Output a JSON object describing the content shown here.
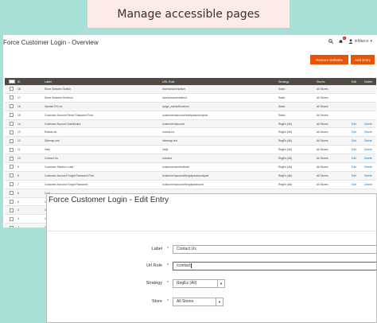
{
  "banner": {
    "text": "Manage accessible pages"
  },
  "overview": {
    "title": "Force Customer Login - Overview",
    "user": "leMarco",
    "notifications": "1",
    "buttons": {
      "restore": "Restore Defaults",
      "add": "Add Entry"
    },
    "columns": [
      "ID",
      "Label",
      "URL Rule",
      "Strategy",
      "Stores",
      "Edit",
      "Delete"
    ],
    "rows": [
      {
        "id": "18",
        "label": "Store Switcher Switch",
        "url": "/stores/store/switch",
        "strategy": "Static",
        "stores": "All Stores",
        "edit": "",
        "delete": ""
      },
      {
        "id": "17",
        "label": "Store Switcher Redirect",
        "url": "/stores/store/redirect",
        "strategy": "Static",
        "stores": "All Stores",
        "edit": "",
        "delete": ""
      },
      {
        "id": "16",
        "label": "Varnish ESI url",
        "url": "/page_cache/block/esi",
        "strategy": "Static",
        "stores": "All Stores",
        "edit": "",
        "delete": ""
      },
      {
        "id": "15",
        "label": "Customer Account Reset Password Post",
        "url": "/customer/account/resetpasswordpost",
        "strategy": "Static",
        "stores": "All Stores",
        "edit": "",
        "delete": ""
      },
      {
        "id": "14",
        "label": "Customer Account Dashboard",
        "url": "/customer/account",
        "strategy": "RegEx (All)",
        "stores": "All Stores",
        "edit": "Edit",
        "delete": "Delete"
      },
      {
        "id": "13",
        "label": "Robots.txt",
        "url": "/robots.txt",
        "strategy": "RegEx (All)",
        "stores": "All Stores",
        "edit": "Edit",
        "delete": "Delete"
      },
      {
        "id": "12",
        "label": "Sitemap.xml",
        "url": "/sitemap.xml",
        "strategy": "RegEx (All)",
        "stores": "All Stores",
        "edit": "Edit",
        "delete": "Delete"
      },
      {
        "id": "11",
        "label": "Help",
        "url": "/help",
        "strategy": "RegEx (All)",
        "stores": "All Stores",
        "edit": "Edit",
        "delete": "Delete"
      },
      {
        "id": "10",
        "label": "Contact Us",
        "url": "/contact",
        "strategy": "RegEx (All)",
        "stores": "All Stores",
        "edit": "Edit",
        "delete": "Delete"
      },
      {
        "id": "9",
        "label": "Customer Session Load",
        "url": "/customer/section/load",
        "strategy": "RegEx (All)",
        "stores": "All Stores",
        "edit": "Edit",
        "delete": "Delete"
      },
      {
        "id": "8",
        "label": "Customer Account Forgot Password Post",
        "url": "/customer/account/forgotpasswordpost",
        "strategy": "RegEx (All)",
        "stores": "All Stores",
        "edit": "Edit",
        "delete": "Delete"
      },
      {
        "id": "7",
        "label": "Customer Account Forgot Password",
        "url": "/customer/account/forgotpassword",
        "strategy": "RegEx (All)",
        "stores": "All Stores",
        "edit": "Edit",
        "delete": "Delete"
      },
      {
        "id": "6",
        "label": "Cust",
        "url": "",
        "strategy": "",
        "stores": "",
        "edit": "",
        "delete": ""
      },
      {
        "id": "5",
        "label": "Cust",
        "url": "",
        "strategy": "",
        "stores": "",
        "edit": "",
        "delete": ""
      },
      {
        "id": "4",
        "label": "Cust",
        "url": "",
        "strategy": "",
        "stores": "",
        "edit": "",
        "delete": ""
      },
      {
        "id": "3",
        "label": "Cust",
        "url": "",
        "strategy": "",
        "stores": "",
        "edit": "",
        "delete": ""
      },
      {
        "id": "2",
        "label": "Cust",
        "url": "",
        "strategy": "",
        "stores": "",
        "edit": "",
        "delete": ""
      }
    ]
  },
  "edit": {
    "title": "Force Customer Login - Edit Entry",
    "fields": {
      "label": {
        "name": "Label",
        "value": "Contact Us"
      },
      "url": {
        "name": "Url Rule",
        "value": "/contact"
      },
      "strategy": {
        "name": "Strategy",
        "value": "RegEx (All)"
      },
      "store": {
        "name": "Store",
        "value": "All Stores"
      }
    },
    "required_mark": "*"
  },
  "colors": {
    "accent": "#eb5202",
    "grid_header": "#514943",
    "link": "#007bdb",
    "background": "#a8dfd6"
  },
  "icons": [
    "search-icon",
    "bell-icon",
    "user-icon",
    "chevron-down-icon"
  ]
}
